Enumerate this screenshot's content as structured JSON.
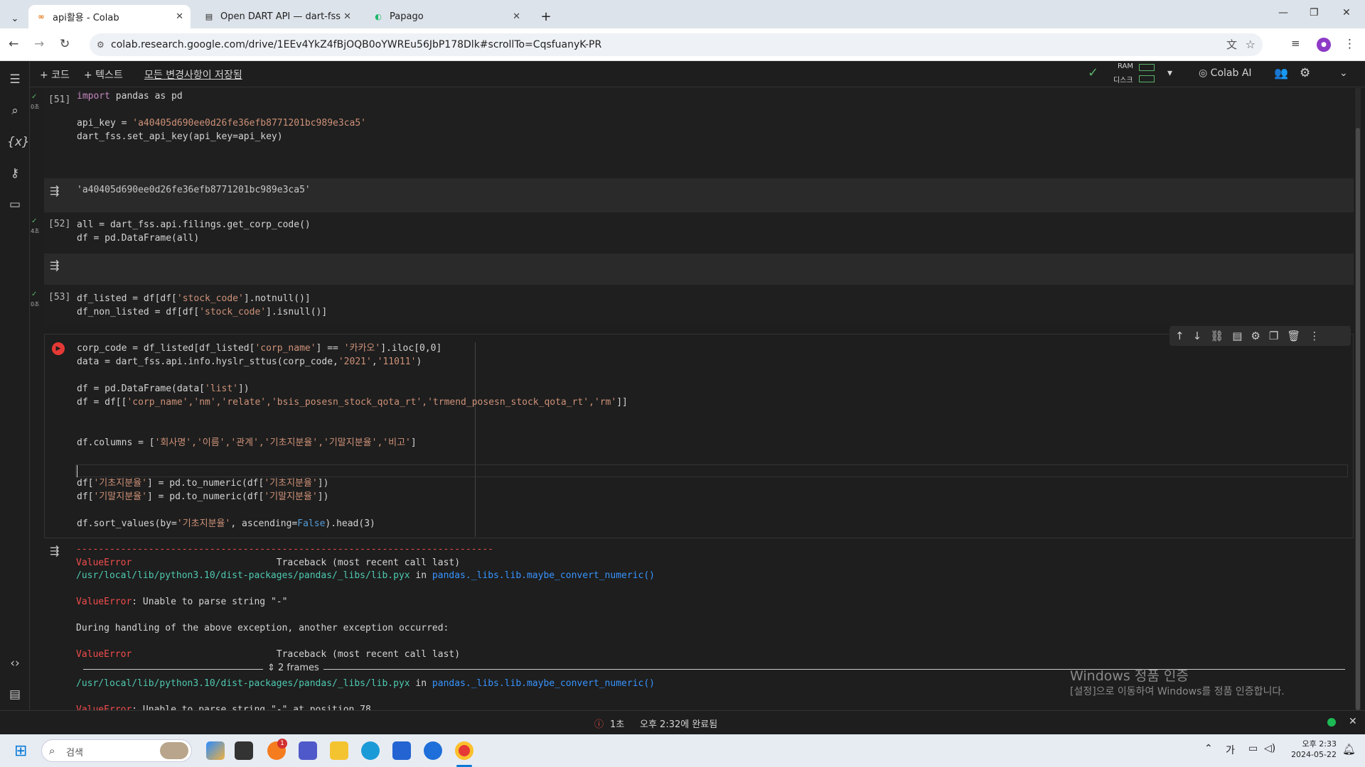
{
  "browser": {
    "tabs": [
      {
        "title": "api활용 - Colab"
      },
      {
        "title": "Open DART API — dart-fss do"
      },
      {
        "title": "Papago"
      }
    ],
    "url": "colab.research.google.com/drive/1EEv4YkZ4fBjOQB0oYWREu56JbP178Dlk#scrollTo=CqsfuanyK-PR"
  },
  "toolbar": {
    "add_code": "+ 코드",
    "add_text": "+ 텍스트",
    "saved_status": "모든 변경사항이 저장됨",
    "ram_label": "RAM",
    "disk_label": "디스크",
    "colab_ai": "Colab AI"
  },
  "cells": [
    {
      "num": "[51]",
      "time": "0초"
    },
    {
      "num": "[52]",
      "time": "4초"
    },
    {
      "num": "[53]",
      "time": "0초"
    }
  ],
  "code": {
    "c51_l1_kw": "import",
    "c51_l1_rest": " pandas as pd",
    "c51_l3_a": "api_key = ",
    "c51_l3_s": "'a40405d690ee0d26fe36efb8771201bc989e3ca5'",
    "c51_l4": "dart_fss.set_api_key(api_key=api_key)",
    "c51_out": "'a40405d690ee0d26fe36efb8771201bc989e3ca5'",
    "c52_l1": "all = dart_fss.api.filings.get_corp_code()",
    "c52_l2": "df = pd.DataFrame(all)",
    "c53_l1a": "df_listed = df[df[",
    "c53_l1s": "'stock_code'",
    "c53_l1b": "].notnull()]",
    "c53_l2a": "df_non_listed = df[df[",
    "c53_l2s": "'stock_code'",
    "c53_l2b": "].isnull()]",
    "c54_l1a": "corp_code = df_listed[df_listed[",
    "c54_l1s": "'corp_name'",
    "c54_l1b": "] == ",
    "c54_l1s2": "'카카오'",
    "c54_l1c": "].iloc[0,0]",
    "c54_l2a": "data = dart_fss.api.info.hyslr_sttus(corp_code,",
    "c54_l2s": "'2021'",
    "c54_l2b": ",",
    "c54_l2s2": "'11011'",
    "c54_l2c": ")",
    "c54_l4a": "df = pd.DataFrame(data[",
    "c54_l4s": "'list'",
    "c54_l4b": "])",
    "c54_l5a": "df = df[[",
    "c54_l5s": "'corp_name','nm','relate','bsis_posesn_stock_qota_rt','trmend_posesn_stock_qota_rt','rm'",
    "c54_l5b": "]]",
    "c54_l8a": "df.columns = [",
    "c54_l8s": "'회사명','이름','관계','기초지분율','기말지분율','비고'",
    "c54_l8b": "]",
    "c54_l11a": "df[",
    "c54_l11s": "'기초지분율'",
    "c54_l11b": "] = pd.to_numeric(df[",
    "c54_l11s2": "'기초지분율'",
    "c54_l11c": "])",
    "c54_l12a": "df[",
    "c54_l12s": "'기말지분율'",
    "c54_l12b": "] = pd.to_numeric(df[",
    "c54_l12s2": "'기말지분율'",
    "c54_l12c": "])",
    "c54_l14a": "df.sort_values(by=",
    "c54_l14s": "'기초지분율'",
    "c54_l14b": ", ascending=",
    "c54_l14k": "False",
    "c54_l14c": ").head(3)"
  },
  "traceback": {
    "dashes": "---------------------------------------------------------------------------",
    "err1": "ValueError",
    "tb1": "Traceback (most recent call last)",
    "path1": "/usr/local/lib/python3.10/dist-packages/pandas/_libs/lib.pyx",
    "in1": " in ",
    "fn1": "pandas._libs.lib.maybe_convert_numeric()",
    "err2": "ValueError",
    "msg2": ": Unable to parse string \"-\"",
    "during": "During handling of the above exception, another exception occurred:",
    "err3": "ValueError",
    "tb3": "Traceback (most recent call last)",
    "frames": "2 frames",
    "path2": "/usr/local/lib/python3.10/dist-packages/pandas/_libs/lib.pyx",
    "in2": " in ",
    "fn2": "pandas._libs.lib.maybe_convert_numeric()",
    "err4": "ValueError",
    "msg4": ": Unable to parse string \"-\" at position 78"
  },
  "watermark": {
    "line1": "Windows 정품 인증",
    "line2": "[설정]으로 이동하여 Windows를 정품 인증합니다."
  },
  "status": {
    "duration": "1초",
    "completed": "오후 2:32에 완료됨"
  },
  "taskbar": {
    "search_placeholder": "검색",
    "badge": "1",
    "ime": "가",
    "time": "오후 2:33",
    "date": "2024-05-22"
  },
  "colors": {
    "accent": "#f9ab00",
    "error": "#f14c4c",
    "string": "#ce9178"
  }
}
